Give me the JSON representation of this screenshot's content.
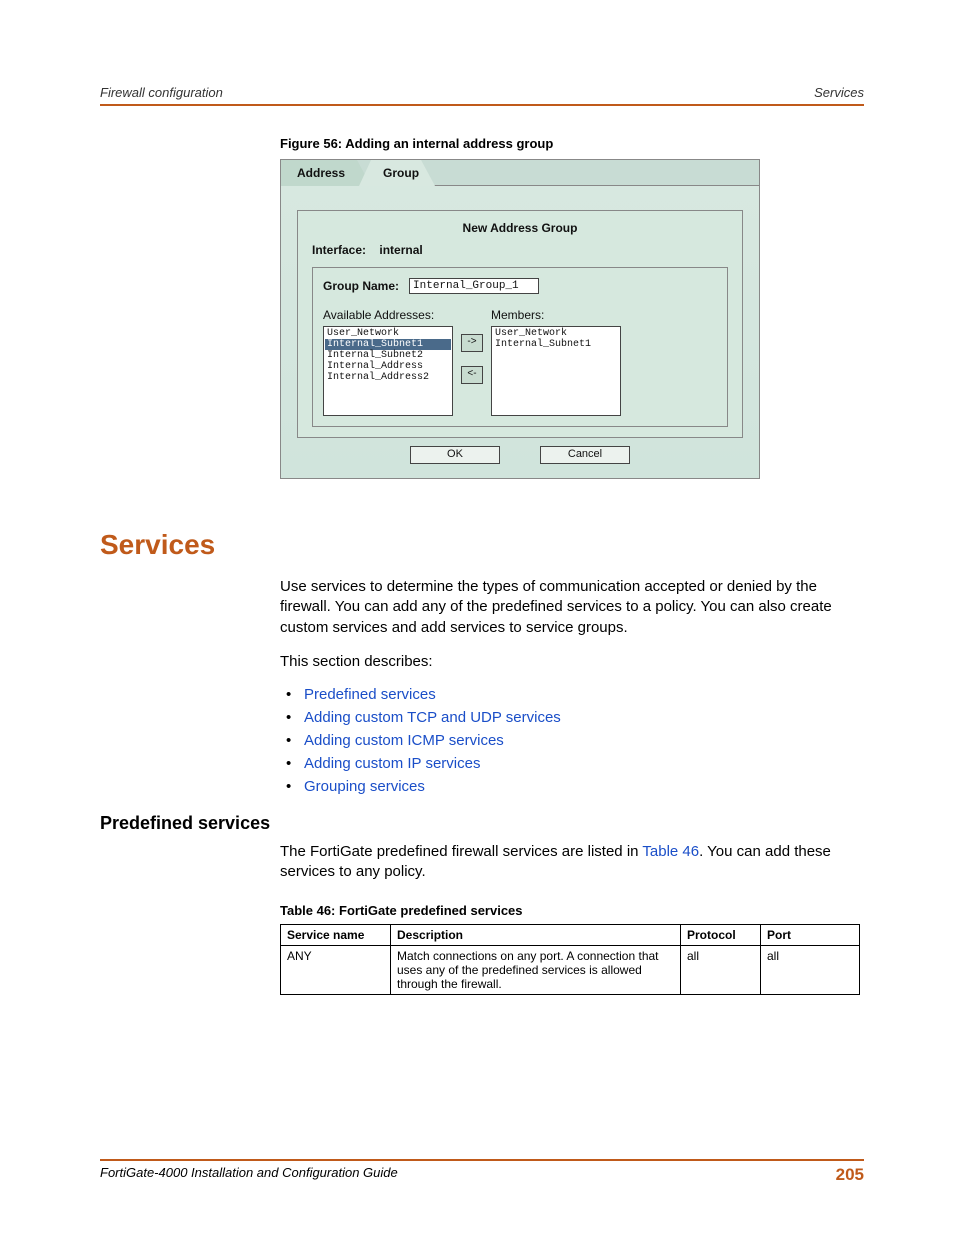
{
  "header": {
    "left": "Firewall configuration",
    "right": "Services"
  },
  "figure": {
    "caption": "Figure 56: Adding an internal address group",
    "tabs": {
      "active": "Address",
      "inactive": "Group"
    },
    "panel_title": "New Address Group",
    "interface_label": "Interface:",
    "interface_value": "internal",
    "group_name_label": "Group Name:",
    "group_name_value": "Internal_Group_1",
    "available_label": "Available Addresses:",
    "available_items": [
      "User_Network",
      "Internal_Subnet1",
      "Internal_Subnet2",
      "Internal_Address",
      "Internal_Address2"
    ],
    "available_selected_index": 1,
    "members_label": "Members:",
    "members_items": [
      "User_Network",
      "Internal_Subnet1"
    ],
    "arrow_right": "->",
    "arrow_left": "<-",
    "ok": "OK",
    "cancel": "Cancel"
  },
  "services": {
    "heading": "Services",
    "para1": "Use services to determine the types of communication accepted or denied by the firewall. You can add any of the predefined services to a policy. You can also create custom services and add services to service groups.",
    "para2": "This section describes:",
    "links": [
      "Predefined services",
      "Adding custom TCP and UDP services",
      "Adding custom ICMP services",
      "Adding custom IP services",
      "Grouping services"
    ]
  },
  "predefined": {
    "heading": "Predefined services",
    "para_a": "The FortiGate predefined firewall services are listed in ",
    "table_link": "Table 46",
    "para_b": ". You can add these services to any policy."
  },
  "table": {
    "caption": "Table 46: FortiGate predefined services",
    "headers": {
      "c1": "Service name",
      "c2": "Description",
      "c3": "Protocol",
      "c4": "Port"
    },
    "rows": [
      {
        "c1": "ANY",
        "c2": "Match connections on any port. A connection that uses any of the predefined services is allowed through the firewall.",
        "c3": "all",
        "c4": "all"
      }
    ]
  },
  "chart_data": {
    "type": "table",
    "title": "Table 46: FortiGate predefined services",
    "columns": [
      "Service name",
      "Description",
      "Protocol",
      "Port"
    ],
    "rows": [
      [
        "ANY",
        "Match connections on any port. A connection that uses any of the predefined services is allowed through the firewall.",
        "all",
        "all"
      ]
    ]
  },
  "footer": {
    "left": "FortiGate-4000 Installation and Configuration Guide",
    "right": "205"
  }
}
